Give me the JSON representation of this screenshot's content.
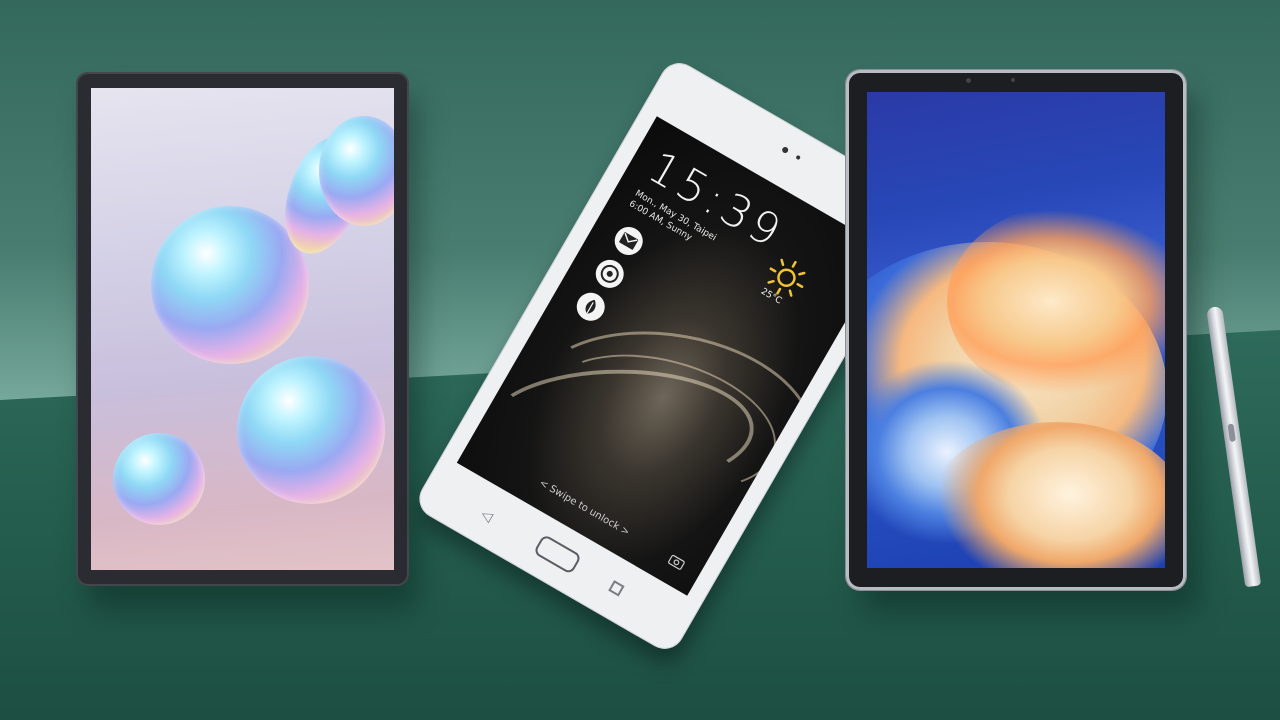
{
  "scene": {
    "colors": {
      "background_top": "#4a7d71",
      "background_band": "#235b4c",
      "tablet_left_body": "#2b2c31",
      "tablet_middle_body": "#eef0f2",
      "tablet_right_body": "#1d1e22",
      "s_pen": "#dfe2e6"
    }
  },
  "lockscreen": {
    "time": "15:39",
    "date_line": "Mon., May 30, Taipei",
    "alarm_line": "6:00 AM, Sunny",
    "temperature": "25°C",
    "swipe_hint": "< Swipe to unlock >",
    "notification_icons": [
      "mail-icon",
      "chrome-icon",
      "leaf-icon"
    ],
    "weather_icon": "sun-icon"
  }
}
